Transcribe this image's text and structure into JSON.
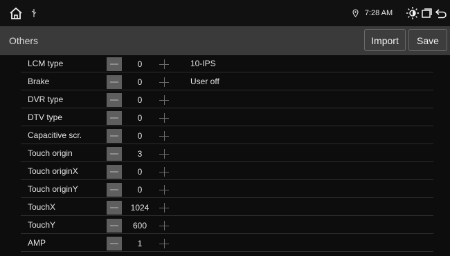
{
  "statusbar": {
    "home_icon": "home-icon",
    "usb_icon": "usb-icon",
    "location_icon": "location-pin-icon",
    "time": "7:28 AM",
    "brightness_icon": "brightness-icon",
    "recent_icon": "recent-apps-icon",
    "back_icon": "back-arrow-icon"
  },
  "header": {
    "title": "Others",
    "import_label": "Import",
    "save_label": "Save"
  },
  "settings": [
    {
      "label": "LCM type",
      "value": "0",
      "desc": "10-IPS"
    },
    {
      "label": "Brake",
      "value": "0",
      "desc": "User off"
    },
    {
      "label": "DVR type",
      "value": "0",
      "desc": ""
    },
    {
      "label": "DTV type",
      "value": "0",
      "desc": ""
    },
    {
      "label": "Capacitive scr.",
      "value": "0",
      "desc": ""
    },
    {
      "label": "Touch origin",
      "value": "3",
      "desc": ""
    },
    {
      "label": "Touch originX",
      "value": "0",
      "desc": ""
    },
    {
      "label": "Touch originY",
      "value": "0",
      "desc": ""
    },
    {
      "label": "TouchX",
      "value": "1024",
      "desc": ""
    },
    {
      "label": "TouchY",
      "value": "600",
      "desc": ""
    },
    {
      "label": "AMP",
      "value": "1",
      "desc": ""
    }
  ],
  "colors": {
    "background": "#0d0d0d",
    "header": "#3a3a3a",
    "minus_button": "#5e5e5e"
  }
}
